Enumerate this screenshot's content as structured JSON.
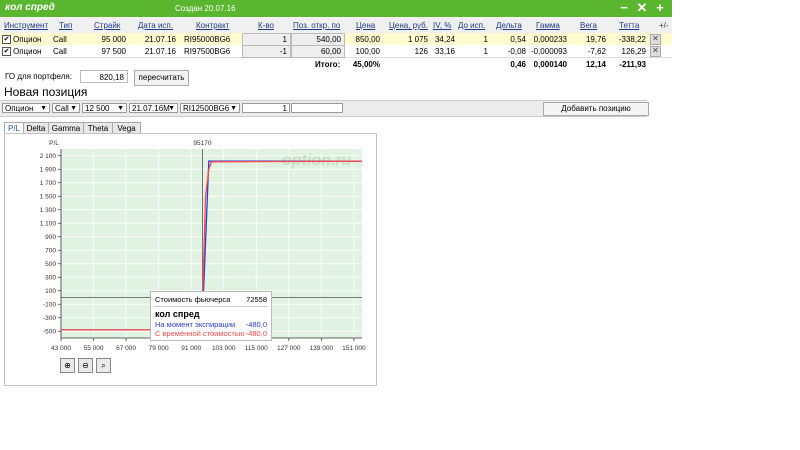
{
  "window": {
    "title": "кол спред",
    "created": "Создан 20.07.16",
    "minimize_icon": "−",
    "close_icon": "✕",
    "add_icon": "+"
  },
  "table": {
    "headers": [
      "Инструмент",
      "Тип",
      "Страйк",
      "Дата исп.",
      "Контракт",
      "К-во",
      "Поз. откр. по",
      "Цена",
      "Цена, руб.",
      "IV, %",
      "До исп.",
      "Дельта",
      "Гамма",
      "Вега",
      "Тетта",
      "+/-"
    ],
    "rows": [
      {
        "checked": true,
        "instrument": "Опцион",
        "type": "Call",
        "strike": "95 000",
        "date": "21.07.16",
        "contract": "RI95000BG6",
        "qty": "1",
        "open_price": "540,00",
        "price": "850,00",
        "price_rub": "1 075",
        "iv": "34,24",
        "days": "1",
        "delta": "0,54",
        "gamma": "0,000233",
        "vega": "19,76",
        "theta": "-338,22"
      },
      {
        "checked": true,
        "instrument": "Опцион",
        "type": "Call",
        "strike": "97 500",
        "date": "21.07.16",
        "contract": "RI97500BG6",
        "qty": "-1",
        "open_price": "60,00",
        "price": "100,00",
        "price_rub": "126",
        "iv": "33,16",
        "days": "1",
        "delta": "-0,08",
        "gamma": "-0,000093",
        "vega": "-7,62",
        "theta": "126,29"
      }
    ],
    "totals": {
      "label": "Итого:",
      "pct": "45,00%",
      "delta": "0,46",
      "gamma": "0,000140",
      "vega": "12,14",
      "theta": "-211,93"
    }
  },
  "portfolio": {
    "go_label": "ГО для портфеля:",
    "go_value": "820,18",
    "recalc_label": "пересчитать"
  },
  "new_position": {
    "title": "Новая позиция",
    "instrument": "Опцион",
    "type": "Call",
    "strike": "12 500",
    "date": "21.07.16M",
    "contract": "RI12500BG6",
    "qty": "1",
    "price": "",
    "add_label": "Добавить позицию"
  },
  "tabs": [
    "P/L",
    "Delta",
    "Gamma",
    "Theta",
    "Vega"
  ],
  "active_tab": "P/L",
  "zoom_buttons": [
    "zoom-in-icon",
    "zoom-out-icon",
    "zoom-reset-icon"
  ],
  "tooltip": {
    "futures_label": "Стоимость фьючерса",
    "futures_value": "72558",
    "strategy": "кол спред",
    "expiry_label": "На момент экспирации",
    "expiry_value": "-480,0",
    "time_label": "С временной стоимостью",
    "time_value": "-480,0"
  },
  "colors": {
    "titlebar": "#5ab52f",
    "expiry_line": "#2b3bd6",
    "time_line": "#ff4a4a",
    "plot_bg": "#e2f2e2"
  },
  "chart_data": {
    "type": "line",
    "xlabel": "",
    "ylabel": "P/L",
    "watermark": "option.ru",
    "marker_label": "95170",
    "marker_x": 95170,
    "xlim": [
      43000,
      154000
    ],
    "ylim": [
      -600,
      2200
    ],
    "xticks": [
      "43 000",
      "55 000",
      "67 000",
      "79 000",
      "91 000",
      "103 000",
      "115 000",
      "127 000",
      "139 000",
      "151 000"
    ],
    "yticks": [
      "2 100",
      "1 900",
      "1 700",
      "1 500",
      "1 300",
      "1 100",
      "900",
      "700",
      "500",
      "300",
      "100",
      "-100",
      "-300",
      "-500"
    ],
    "series": [
      {
        "name": "На момент экспирации",
        "color": "#2b3bd6",
        "x": [
          43000,
          95000,
          95000,
          97500,
          154000
        ],
        "y": [
          -480,
          -480,
          -480,
          2020,
          2020
        ]
      },
      {
        "name": "С временной стоимостью",
        "color": "#ff4a4a",
        "x": [
          43000,
          94800,
          95500,
          96300,
          97500,
          98500,
          154000
        ],
        "y": [
          -480,
          -480,
          400,
          1500,
          1900,
          2010,
          2020
        ]
      }
    ]
  }
}
